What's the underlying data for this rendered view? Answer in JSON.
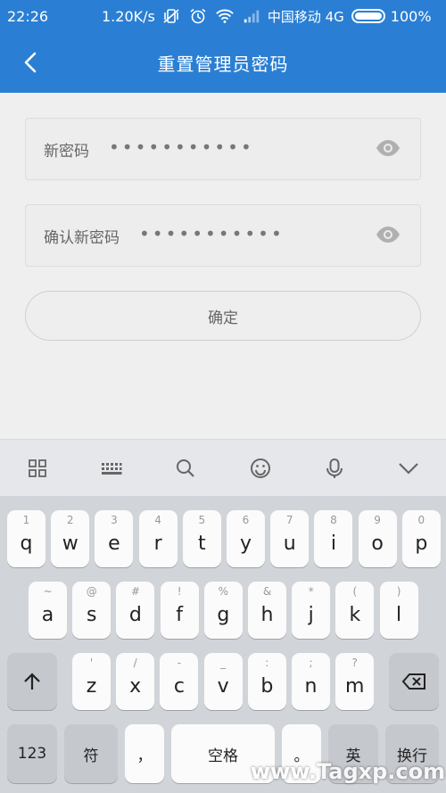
{
  "status_bar": {
    "time": "22:26",
    "speed": "1.20K/s",
    "carrier": "中国移动 4G",
    "battery": "100%"
  },
  "header": {
    "title": "重置管理员密码"
  },
  "form": {
    "new_password_label": "新密码",
    "new_password_value": "•••••••••••",
    "confirm_password_label": "确认新密码",
    "confirm_password_value": "•••••••••••",
    "confirm_button": "确定"
  },
  "keyboard": {
    "row1": [
      {
        "k": "q",
        "s": "1"
      },
      {
        "k": "w",
        "s": "2"
      },
      {
        "k": "e",
        "s": "3"
      },
      {
        "k": "r",
        "s": "4"
      },
      {
        "k": "t",
        "s": "5"
      },
      {
        "k": "y",
        "s": "6"
      },
      {
        "k": "u",
        "s": "7"
      },
      {
        "k": "i",
        "s": "8"
      },
      {
        "k": "o",
        "s": "9"
      },
      {
        "k": "p",
        "s": "0"
      }
    ],
    "row2": [
      {
        "k": "a",
        "s": "~"
      },
      {
        "k": "s",
        "s": "@"
      },
      {
        "k": "d",
        "s": "#"
      },
      {
        "k": "f",
        "s": "!"
      },
      {
        "k": "g",
        "s": "%"
      },
      {
        "k": "h",
        "s": "&"
      },
      {
        "k": "j",
        "s": "*"
      },
      {
        "k": "k",
        "s": "("
      },
      {
        "k": "l",
        "s": ")"
      }
    ],
    "row3": [
      {
        "k": "z",
        "s": "'"
      },
      {
        "k": "x",
        "s": "/"
      },
      {
        "k": "c",
        "s": "-"
      },
      {
        "k": "v",
        "s": "_"
      },
      {
        "k": "b",
        "s": ":"
      },
      {
        "k": "n",
        "s": ";"
      },
      {
        "k": "m",
        "s": "?"
      }
    ],
    "key_123": "123",
    "key_symbol": "符",
    "key_comma": "，",
    "key_space": "空格",
    "key_period": "。",
    "key_lang": "英",
    "key_enter": "换行"
  },
  "watermark": "www.Tagxp.com"
}
